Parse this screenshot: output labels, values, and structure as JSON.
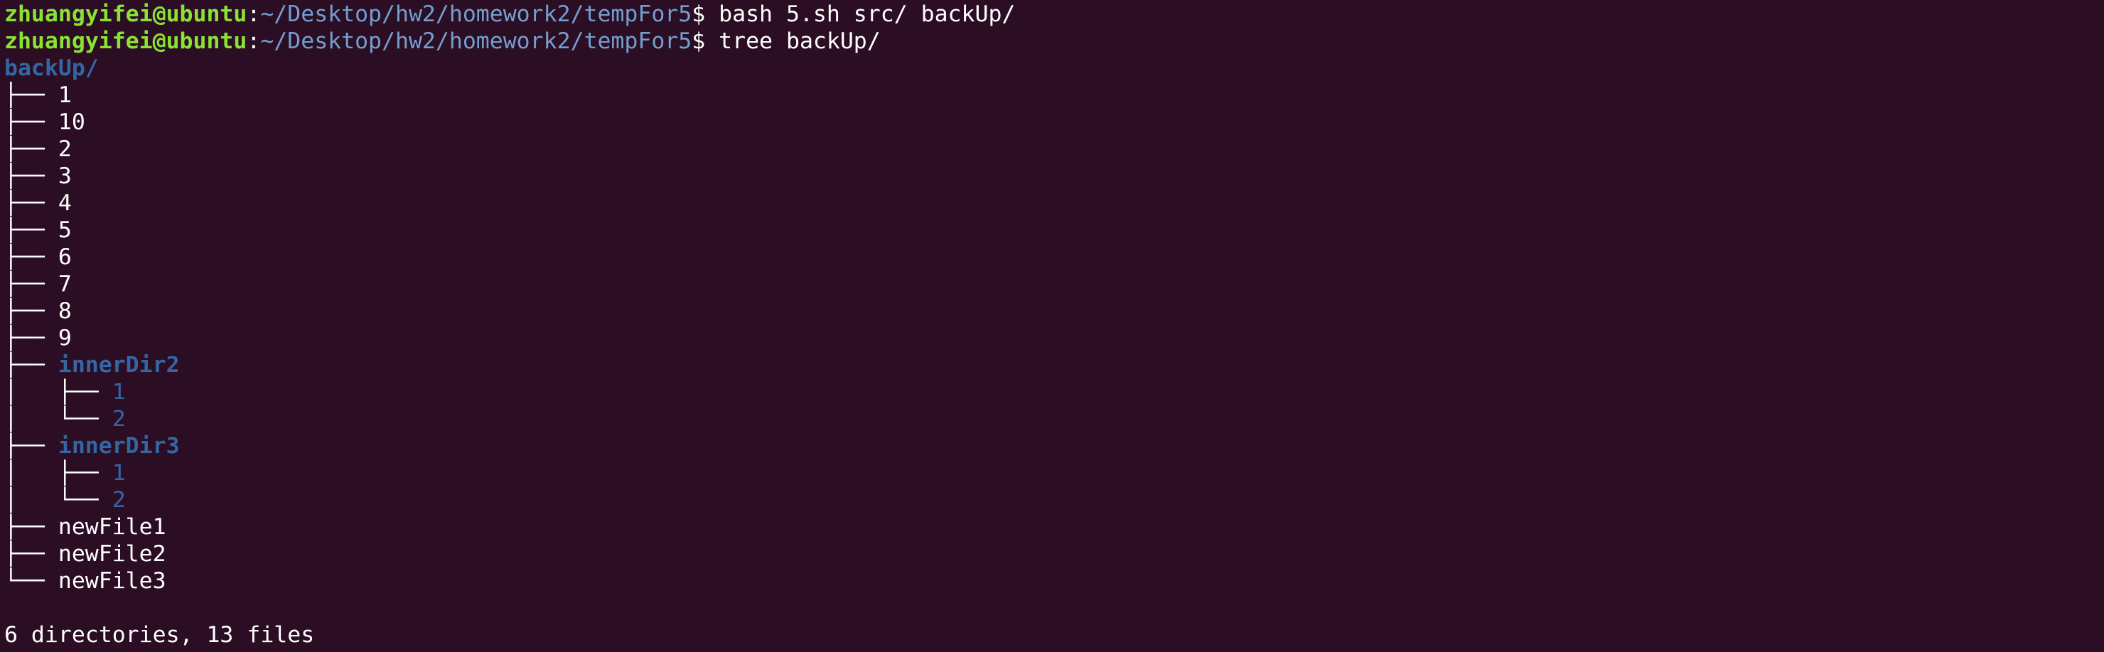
{
  "prompt": {
    "user_host": "zhuangyifei@ubuntu",
    "colon": ":",
    "path": "~/Desktop/hw2/homework2/tempFor5",
    "dollar": "$ "
  },
  "commands": [
    "bash 5.sh src/ backUp/",
    "tree backUp/"
  ],
  "tree": {
    "root": "backUp/",
    "lines": [
      {
        "prefix": "├── ",
        "name": "1",
        "kind": "file"
      },
      {
        "prefix": "├── ",
        "name": "10",
        "kind": "file"
      },
      {
        "prefix": "├── ",
        "name": "2",
        "kind": "file"
      },
      {
        "prefix": "├── ",
        "name": "3",
        "kind": "file"
      },
      {
        "prefix": "├── ",
        "name": "4",
        "kind": "file"
      },
      {
        "prefix": "├── ",
        "name": "5",
        "kind": "file"
      },
      {
        "prefix": "├── ",
        "name": "6",
        "kind": "file"
      },
      {
        "prefix": "├── ",
        "name": "7",
        "kind": "file"
      },
      {
        "prefix": "├── ",
        "name": "8",
        "kind": "file"
      },
      {
        "prefix": "├── ",
        "name": "9",
        "kind": "file"
      },
      {
        "prefix": "├── ",
        "name": "innerDir2",
        "kind": "dir"
      },
      {
        "prefix": "│   ├── ",
        "name": "1",
        "kind": "dirfile"
      },
      {
        "prefix": "│   └── ",
        "name": "2",
        "kind": "dirfile"
      },
      {
        "prefix": "├── ",
        "name": "innerDir3",
        "kind": "dir"
      },
      {
        "prefix": "│   ├── ",
        "name": "1",
        "kind": "dirfile"
      },
      {
        "prefix": "│   └── ",
        "name": "2",
        "kind": "dirfile"
      },
      {
        "prefix": "├── ",
        "name": "newFile1",
        "kind": "file"
      },
      {
        "prefix": "├── ",
        "name": "newFile2",
        "kind": "file"
      },
      {
        "prefix": "└── ",
        "name": "newFile3",
        "kind": "file"
      }
    ]
  },
  "summary": "6 directories, 13 files",
  "colors": {
    "background": "#2c0e24",
    "prompt_user": "#8ae234",
    "prompt_path": "#729fcf",
    "directory": "#3465a4",
    "text": "#ffffff"
  }
}
